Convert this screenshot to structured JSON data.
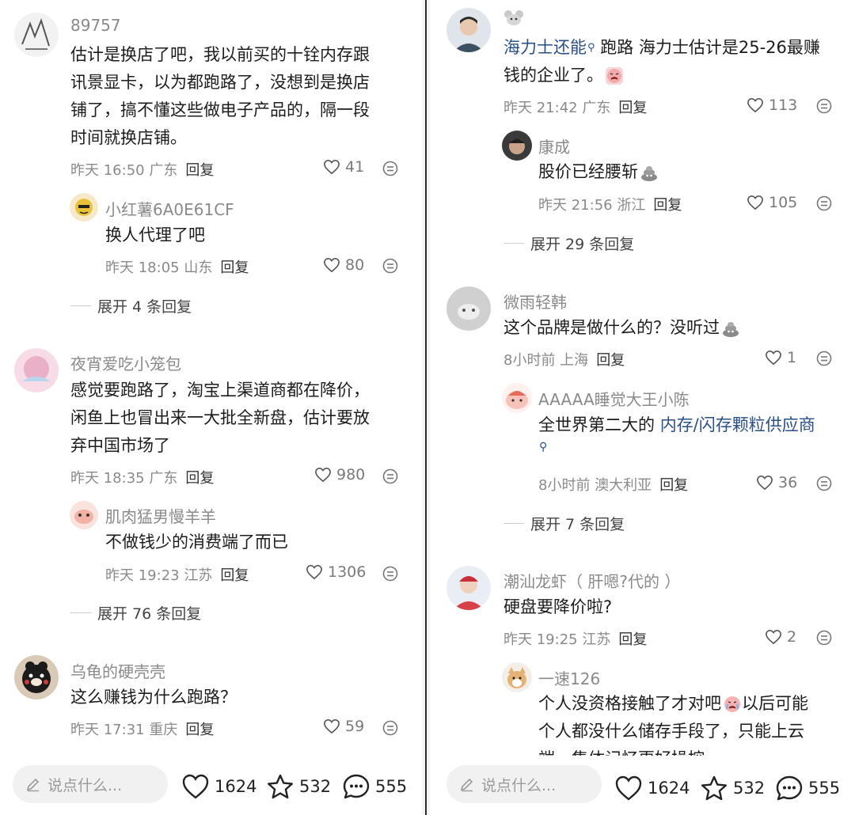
{
  "left": {
    "comments": [
      {
        "name": "89757",
        "lines": [
          "估计是换店了吧，我以前买的十铨内存跟",
          "讯景显卡，以为都跑路了，没想到是换店",
          "铺了，搞不懂这些做电子产品的，隔一段",
          "时间就换店铺。"
        ],
        "time": "昨天 16:50 广东",
        "reply": "回复",
        "likes": "41",
        "sub": {
          "name": "小红薯6A0E61CF",
          "text": "换人代理了吧",
          "time": "昨天 18:05 山东",
          "reply": "回复",
          "likes": "80"
        },
        "expand": "展开 4 条回复"
      },
      {
        "name": "夜宵爱吃小笼包",
        "lines": [
          "感觉要跑路了，淘宝上渠道商都在降价，",
          "闲鱼上也冒出来一大批全新盘，估计要放",
          "弃中国市场了"
        ],
        "time": "昨天 18:35 广东",
        "reply": "回复",
        "likes": "980",
        "sub": {
          "name": "肌肉猛男慢羊羊",
          "text": "不做钱少的消费端了而已",
          "time": "昨天 19:23 江苏",
          "reply": "回复",
          "likes": "1306"
        },
        "expand": "展开 76 条回复"
      },
      {
        "name": "乌龟的硬壳壳",
        "lines": [
          "这么赚钱为什么跑路？"
        ],
        "time": "昨天 17:31 重庆",
        "reply": "回复",
        "likes": "59"
      }
    ],
    "bottom": {
      "placeholder": "说点什么...",
      "likes": "1624",
      "stars": "532",
      "comments": "555"
    }
  },
  "right": {
    "comments": [
      {
        "name": "",
        "link": "海力士还能",
        "line1_rest": " 跑路 海力士估计是25-26最赚",
        "line2": "钱的企业了。",
        "time": "昨天 21:42 广东",
        "reply": "回复",
        "likes": "113",
        "sub": {
          "name": "康成",
          "text": "股价已经腰斩",
          "time": "昨天 21:56 浙江",
          "reply": "回复",
          "likes": "105"
        },
        "expand": "展开 29 条回复"
      },
      {
        "name": "微雨轻韩",
        "text": "这个品牌是做什么的？没听过",
        "time": "8小时前 上海",
        "reply": "回复",
        "likes": "1",
        "sub": {
          "name": "AAAAA睡觉大王小陈",
          "text_pre": "全世界第二大的 ",
          "link": "内存/闪存颗粒供应商",
          "time": "8小时前 澳大利亚",
          "reply": "回复",
          "likes": "36"
        },
        "expand": "展开 7 条回复"
      },
      {
        "name": "潮汕龙虾（ 肝嗯?代的 ）",
        "text": "硬盘要降价啦?",
        "time": "昨天 19:25 江苏",
        "reply": "回复",
        "likes": "2",
        "sub": {
          "name": "一速126",
          "line1_pre": "个人没资格接触了才对吧",
          "line1_post": "以后可能",
          "line2": "个人都没什么储存手段了，只能上云",
          "line3": "端，集体记忆更好操控"
        }
      }
    ],
    "bottom": {
      "placeholder": "说点什么...",
      "likes": "1624",
      "stars": "532",
      "comments": "555"
    }
  }
}
